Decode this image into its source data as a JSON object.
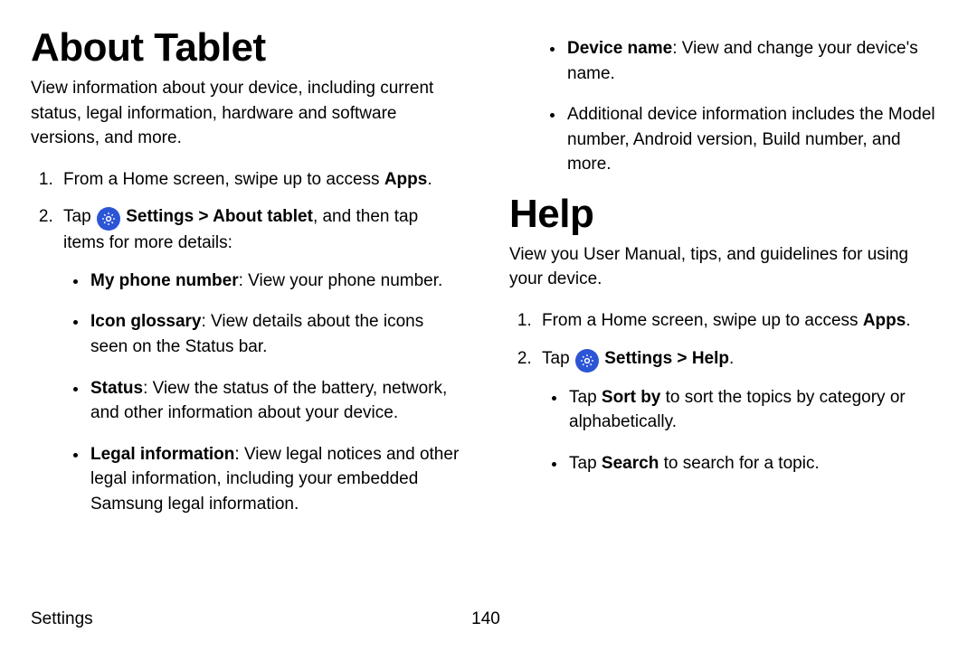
{
  "left": {
    "heading": "About Tablet",
    "intro": "View information about your device, including current status, legal information, hardware and software versions, and more.",
    "step1_a": "From a Home screen, swipe up to access ",
    "step1_b": "Apps",
    "step1_c": ".",
    "step2_a": "Tap ",
    "step2_b": "Settings",
    "step2_chev": " > ",
    "step2_c": "About tablet",
    "step2_d": ", and then tap items for more details:",
    "bullets": {
      "b1_a": "My phone number",
      "b1_b": ": View your phone number.",
      "b2_a": "Icon glossary",
      "b2_b": ": View details about the icons seen on the Status bar.",
      "b3_a": "Status",
      "b3_b": ": View the status of the battery, network, and other information about your device.",
      "b4_a": "Legal information",
      "b4_b": ": View legal notices and other legal information, including your embedded Samsung legal information."
    }
  },
  "right": {
    "top": {
      "b1_a": "Device name",
      "b1_b": ": View and change your device's name.",
      "b2": "Additional device information includes the Model number, Android version, Build number, and more."
    },
    "heading": "Help",
    "intro": "View  you User Manual, tips, and guidelines for using your device.",
    "step1_a": "From a Home screen, swipe up to access ",
    "step1_b": "Apps",
    "step1_c": ".",
    "step2_a": "Tap ",
    "step2_b": "Settings",
    "step2_chev": " > ",
    "step2_c": "Help",
    "step2_d": ".",
    "bullets": {
      "b1_a": "Tap ",
      "b1_b": "Sort by",
      "b1_c": " to sort the topics by category or alphabetically.",
      "b2_a": "Tap ",
      "b2_b": "Search",
      "b2_c": " to search for a topic."
    }
  },
  "footer": {
    "section": "Settings",
    "page": "140"
  }
}
